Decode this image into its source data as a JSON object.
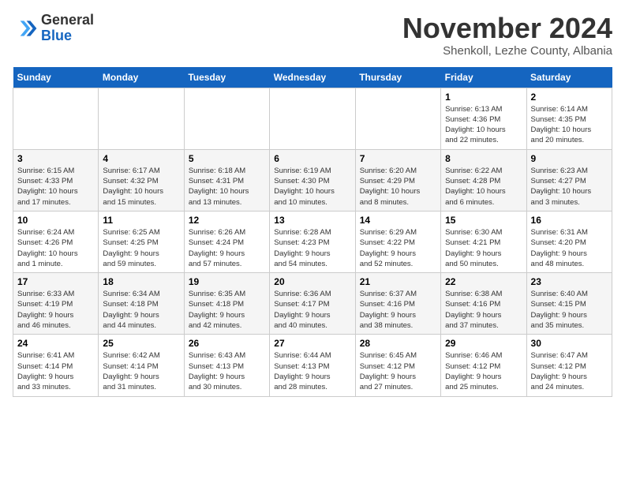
{
  "header": {
    "logo_line1": "General",
    "logo_line2": "Blue",
    "month": "November 2024",
    "location": "Shenkoll, Lezhe County, Albania"
  },
  "weekdays": [
    "Sunday",
    "Monday",
    "Tuesday",
    "Wednesday",
    "Thursday",
    "Friday",
    "Saturday"
  ],
  "weeks": [
    [
      {
        "day": "",
        "info": ""
      },
      {
        "day": "",
        "info": ""
      },
      {
        "day": "",
        "info": ""
      },
      {
        "day": "",
        "info": ""
      },
      {
        "day": "",
        "info": ""
      },
      {
        "day": "1",
        "info": "Sunrise: 6:13 AM\nSunset: 4:36 PM\nDaylight: 10 hours\nand 22 minutes."
      },
      {
        "day": "2",
        "info": "Sunrise: 6:14 AM\nSunset: 4:35 PM\nDaylight: 10 hours\nand 20 minutes."
      }
    ],
    [
      {
        "day": "3",
        "info": "Sunrise: 6:15 AM\nSunset: 4:33 PM\nDaylight: 10 hours\nand 17 minutes."
      },
      {
        "day": "4",
        "info": "Sunrise: 6:17 AM\nSunset: 4:32 PM\nDaylight: 10 hours\nand 15 minutes."
      },
      {
        "day": "5",
        "info": "Sunrise: 6:18 AM\nSunset: 4:31 PM\nDaylight: 10 hours\nand 13 minutes."
      },
      {
        "day": "6",
        "info": "Sunrise: 6:19 AM\nSunset: 4:30 PM\nDaylight: 10 hours\nand 10 minutes."
      },
      {
        "day": "7",
        "info": "Sunrise: 6:20 AM\nSunset: 4:29 PM\nDaylight: 10 hours\nand 8 minutes."
      },
      {
        "day": "8",
        "info": "Sunrise: 6:22 AM\nSunset: 4:28 PM\nDaylight: 10 hours\nand 6 minutes."
      },
      {
        "day": "9",
        "info": "Sunrise: 6:23 AM\nSunset: 4:27 PM\nDaylight: 10 hours\nand 3 minutes."
      }
    ],
    [
      {
        "day": "10",
        "info": "Sunrise: 6:24 AM\nSunset: 4:26 PM\nDaylight: 10 hours\nand 1 minute."
      },
      {
        "day": "11",
        "info": "Sunrise: 6:25 AM\nSunset: 4:25 PM\nDaylight: 9 hours\nand 59 minutes."
      },
      {
        "day": "12",
        "info": "Sunrise: 6:26 AM\nSunset: 4:24 PM\nDaylight: 9 hours\nand 57 minutes."
      },
      {
        "day": "13",
        "info": "Sunrise: 6:28 AM\nSunset: 4:23 PM\nDaylight: 9 hours\nand 54 minutes."
      },
      {
        "day": "14",
        "info": "Sunrise: 6:29 AM\nSunset: 4:22 PM\nDaylight: 9 hours\nand 52 minutes."
      },
      {
        "day": "15",
        "info": "Sunrise: 6:30 AM\nSunset: 4:21 PM\nDaylight: 9 hours\nand 50 minutes."
      },
      {
        "day": "16",
        "info": "Sunrise: 6:31 AM\nSunset: 4:20 PM\nDaylight: 9 hours\nand 48 minutes."
      }
    ],
    [
      {
        "day": "17",
        "info": "Sunrise: 6:33 AM\nSunset: 4:19 PM\nDaylight: 9 hours\nand 46 minutes."
      },
      {
        "day": "18",
        "info": "Sunrise: 6:34 AM\nSunset: 4:18 PM\nDaylight: 9 hours\nand 44 minutes."
      },
      {
        "day": "19",
        "info": "Sunrise: 6:35 AM\nSunset: 4:18 PM\nDaylight: 9 hours\nand 42 minutes."
      },
      {
        "day": "20",
        "info": "Sunrise: 6:36 AM\nSunset: 4:17 PM\nDaylight: 9 hours\nand 40 minutes."
      },
      {
        "day": "21",
        "info": "Sunrise: 6:37 AM\nSunset: 4:16 PM\nDaylight: 9 hours\nand 38 minutes."
      },
      {
        "day": "22",
        "info": "Sunrise: 6:38 AM\nSunset: 4:16 PM\nDaylight: 9 hours\nand 37 minutes."
      },
      {
        "day": "23",
        "info": "Sunrise: 6:40 AM\nSunset: 4:15 PM\nDaylight: 9 hours\nand 35 minutes."
      }
    ],
    [
      {
        "day": "24",
        "info": "Sunrise: 6:41 AM\nSunset: 4:14 PM\nDaylight: 9 hours\nand 33 minutes."
      },
      {
        "day": "25",
        "info": "Sunrise: 6:42 AM\nSunset: 4:14 PM\nDaylight: 9 hours\nand 31 minutes."
      },
      {
        "day": "26",
        "info": "Sunrise: 6:43 AM\nSunset: 4:13 PM\nDaylight: 9 hours\nand 30 minutes."
      },
      {
        "day": "27",
        "info": "Sunrise: 6:44 AM\nSunset: 4:13 PM\nDaylight: 9 hours\nand 28 minutes."
      },
      {
        "day": "28",
        "info": "Sunrise: 6:45 AM\nSunset: 4:12 PM\nDaylight: 9 hours\nand 27 minutes."
      },
      {
        "day": "29",
        "info": "Sunrise: 6:46 AM\nSunset: 4:12 PM\nDaylight: 9 hours\nand 25 minutes."
      },
      {
        "day": "30",
        "info": "Sunrise: 6:47 AM\nSunset: 4:12 PM\nDaylight: 9 hours\nand 24 minutes."
      }
    ]
  ]
}
